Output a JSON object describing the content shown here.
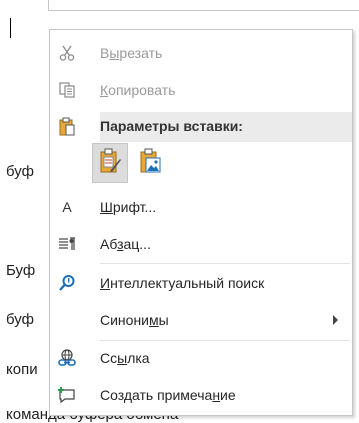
{
  "document": {
    "lines": [
      "буф",
      "Буф",
      "буф",
      "копи",
      "команда буфера обмена"
    ]
  },
  "menu": {
    "cut": {
      "pre": "В",
      "u": "ы",
      "post": "резать",
      "icon": "scissors-icon"
    },
    "copy": {
      "pre": "",
      "u": "К",
      "post": "опировать",
      "icon": "copy-icon"
    },
    "paste_header": "Параметры вставки:",
    "font": {
      "pre": "",
      "u": "Ш",
      "post": "рифт...",
      "icon": "font-icon",
      "glyph": "A"
    },
    "paragraph": {
      "pre": "Аб",
      "u": "з",
      "post": "ац...",
      "icon": "paragraph-icon"
    },
    "smart_lookup": {
      "pre": "",
      "u": "И",
      "post": "нтеллектуальный поиск",
      "icon": "search-icon"
    },
    "synonyms": {
      "pre": "Синони",
      "u": "м",
      "post": "ы",
      "icon": "chevron-right-icon"
    },
    "link": {
      "pre": "Сс",
      "u": "ы",
      "post": "лка",
      "icon": "link-icon"
    },
    "comment": {
      "pre": "Создать примеча",
      "u": "н",
      "post": "ие",
      "icon": "new-comment-icon"
    }
  },
  "colors": {
    "accent_blue": "#1f6fb5",
    "disabled": "#9a9a9a",
    "header_bg": "#ebebeb",
    "clipboard_yellow": "#e6a83a"
  }
}
